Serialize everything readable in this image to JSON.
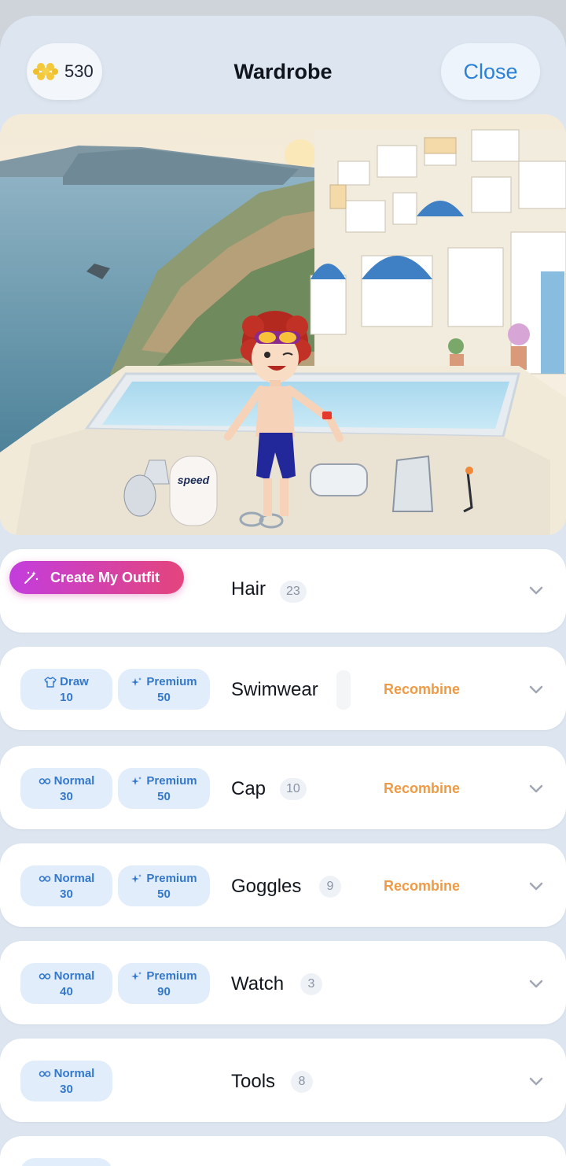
{
  "header": {
    "coins": "530",
    "title": "Wardrobe",
    "close_label": "Close"
  },
  "scene": {
    "kickboard_text": "speed"
  },
  "create_button_label": "Create My Outfit",
  "recombine_label": "Recombine",
  "categories": [
    {
      "name": "Hair",
      "count": "23"
    },
    {
      "name": "Swimwear",
      "chips": [
        {
          "label": "Draw",
          "value": "10",
          "icon": "shirt-icon"
        },
        {
          "label": "Premium",
          "value": "50",
          "icon": "sparkle-icon"
        }
      ]
    },
    {
      "name": "Cap",
      "count": "10",
      "chips": [
        {
          "label": "Normal",
          "value": "30",
          "icon": "infinity-icon"
        },
        {
          "label": "Premium",
          "value": "50",
          "icon": "sparkle-icon"
        }
      ]
    },
    {
      "name": "Goggles",
      "count": "9",
      "chips": [
        {
          "label": "Normal",
          "value": "30",
          "icon": "infinity-icon"
        },
        {
          "label": "Premium",
          "value": "50",
          "icon": "sparkle-icon"
        }
      ]
    },
    {
      "name": "Watch",
      "count": "3",
      "chips": [
        {
          "label": "Normal",
          "value": "40",
          "icon": "infinity-icon"
        },
        {
          "label": "Premium",
          "value": "90",
          "icon": "sparkle-icon"
        }
      ]
    },
    {
      "name": "Tools",
      "count": "8",
      "chips": [
        {
          "label": "Normal",
          "value": "30",
          "icon": "infinity-icon"
        }
      ]
    }
  ],
  "colors": {
    "accent_blue": "#2c80d6",
    "chip_bg": "#e1edfb",
    "recombine_orange": "#ef9a44",
    "gradient_start": "#c33ddd",
    "gradient_end": "#e4457c"
  }
}
